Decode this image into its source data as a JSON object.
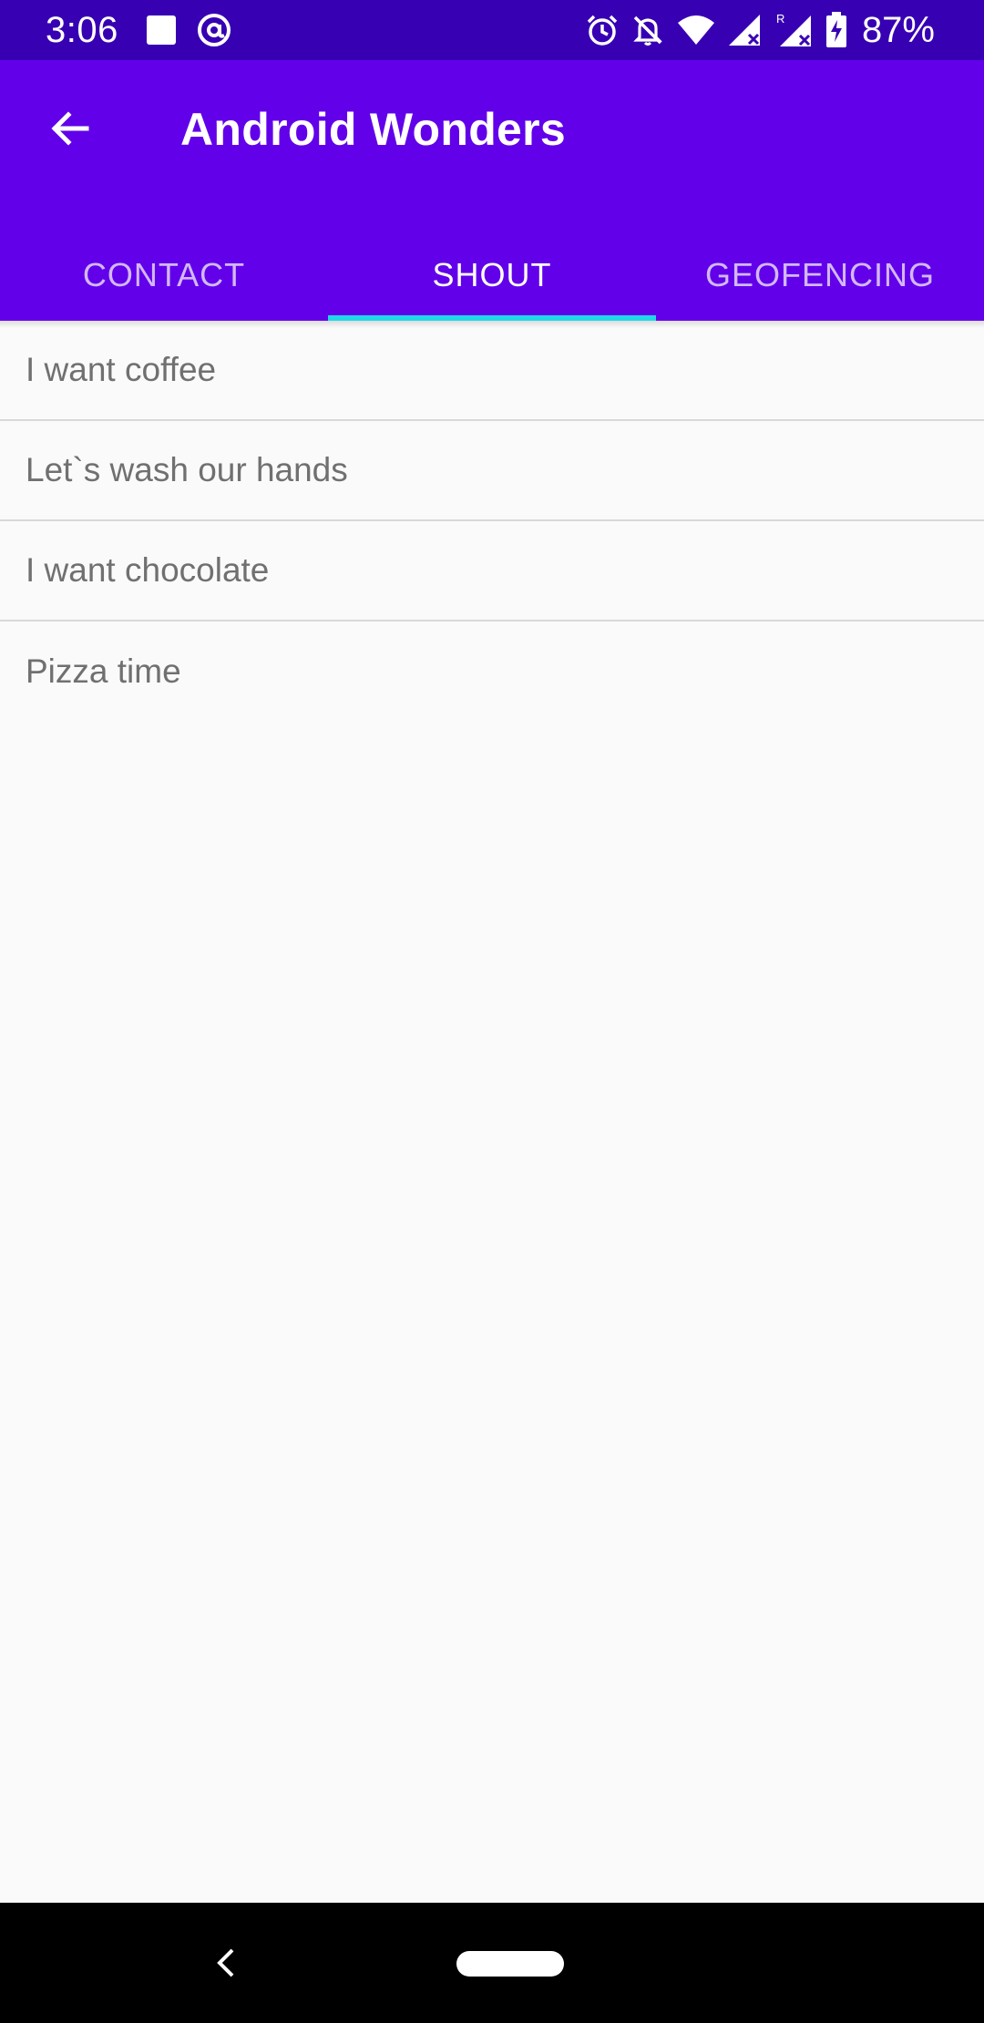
{
  "status_bar": {
    "time": "3:06",
    "battery_percent": "87%",
    "left_icons": [
      "square-notification-icon",
      "at-sign-notification-icon"
    ],
    "right_icons": [
      "alarm-icon",
      "notifications-off-icon",
      "wifi-icon",
      "signal-icon",
      "signal-roaming-icon",
      "battery-charging-icon"
    ],
    "background_color": "#3700b3"
  },
  "app_bar": {
    "title": "Android Wonders",
    "back_icon": "arrow-back-icon",
    "background_color": "#6200ea"
  },
  "tabs": [
    {
      "label": "CONTACT",
      "active": false
    },
    {
      "label": "SHOUT",
      "active": true
    },
    {
      "label": "GEOFENCING",
      "active": false
    }
  ],
  "tab_indicator_color": "#20d8e8",
  "shout_list": {
    "items": [
      {
        "label": "I want coffee"
      },
      {
        "label": "Let`s wash our hands"
      },
      {
        "label": "I want chocolate"
      },
      {
        "label": "Pizza time"
      }
    ]
  },
  "navigation_bar": {
    "back_icon": "nav-back-chevron-icon",
    "home_icon": "home-pill-icon"
  }
}
